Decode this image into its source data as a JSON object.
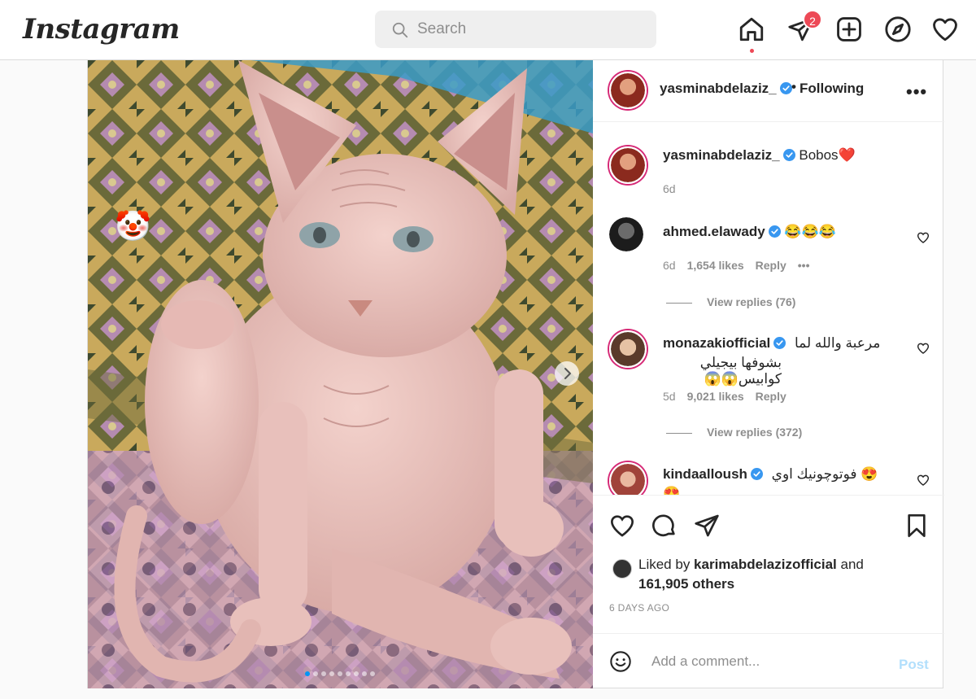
{
  "app": {
    "logo": "Instagram"
  },
  "search": {
    "placeholder": "Search"
  },
  "nav": {
    "icons": [
      "home-icon",
      "direct-icon",
      "new-post-icon",
      "explore-icon",
      "activity-heart-icon"
    ],
    "direct_badge": "2"
  },
  "post": {
    "author": "yasminabdelaziz_",
    "follow_status": "Following",
    "separator": "•",
    "more": "•••",
    "caption": {
      "user": "yasminabdelaziz_",
      "text": "Bobos❤️",
      "time": "6d"
    },
    "comments": [
      {
        "user": "ahmed.elawady",
        "text": "😂😂😂",
        "time": "6d",
        "likes": "1,654 likes",
        "reply": "Reply",
        "more": "•••",
        "view_replies": "View replies (76)"
      },
      {
        "user": "monazakiofficial",
        "text_line1": "مرعبة والله لما",
        "text_line2": "بشوفها بيجيلي كوابيس😱😱",
        "time": "5d",
        "likes": "9,021 likes",
        "reply": "Reply",
        "view_replies": "View replies (372)"
      },
      {
        "user": "kindaalloush",
        "text": "فوتوچونيك اوي 😍",
        "text_overflow": "😍"
      }
    ],
    "liked_by_prefix": "Liked by ",
    "liked_by_user": "karimabdelazizofficial",
    "liked_by_and": " and",
    "liked_by_count": "161,905 others",
    "timestamp": "6 DAYS AGO",
    "add_comment": {
      "placeholder": "Add a comment...",
      "post_label": "Post",
      "emoji_icon": "smiley-icon"
    },
    "carousel": {
      "slides": 9,
      "active": 1
    },
    "photo_sticker": "🤡"
  },
  "colors": {
    "accent": "#0095f6",
    "badge": "#ed4956",
    "post_disabled": "#b2dffc",
    "verified": "#3897f0"
  }
}
